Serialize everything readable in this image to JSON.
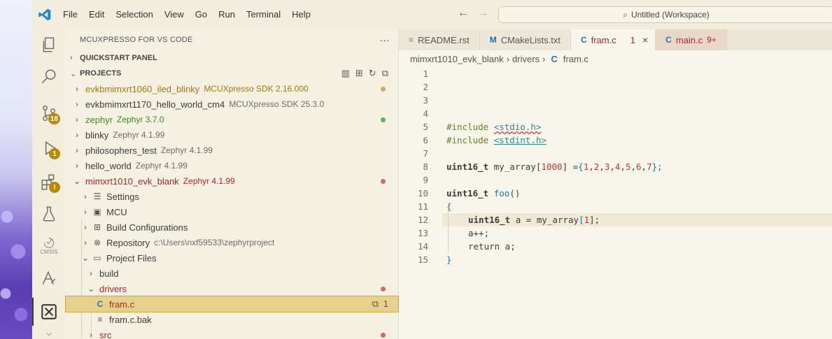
{
  "titlebar": {
    "menu": [
      "File",
      "Edit",
      "Selection",
      "View",
      "Go",
      "Run",
      "Terminal",
      "Help"
    ],
    "command_center": "Untitled (Workspace)"
  },
  "activity": {
    "scm_badge": "18",
    "debug_badge": "1",
    "cmsis_label": "CMSIS"
  },
  "sidebar": {
    "title": "MCUXPRESSO FOR VS CODE",
    "more": "···",
    "quickstart": "QUICKSTART PANEL",
    "projects": "PROJECTS",
    "project_list": [
      {
        "name": "evkbmimxrt1060_iled_blinky",
        "desc": "MCUXpresso SDK 2.16.000"
      },
      {
        "name": "evkbmimxrt1170_hello_world_cm4",
        "desc": "MCUXpresso SDK 25.3.0"
      },
      {
        "name": "zephyr",
        "desc": "Zephyr 3.7.0"
      },
      {
        "name": "blinky",
        "desc": "Zephyr 4.1.99"
      },
      {
        "name": "philosophers_test",
        "desc": "Zephyr 4.1.99"
      },
      {
        "name": "hello_world",
        "desc": "Zephyr 4.1.99"
      },
      {
        "name": "mimxrt1010_evk_blank",
        "desc": "Zephyr 4.1.99"
      }
    ],
    "children": {
      "settings": "Settings",
      "mcu": "MCU",
      "build_configs": "Build Configurations",
      "repository": "Repository",
      "repository_path": "c:\\Users\\nxf59533\\zephyrproject",
      "project_files": "Project Files",
      "build": "build",
      "drivers": "drivers",
      "fram_c": "fram.c",
      "fram_c_count": "1",
      "fram_c_bak": "fram.c.bak",
      "src": "src"
    }
  },
  "editor": {
    "tabs": [
      {
        "label": "README.rst",
        "icon": "≡",
        "suffix": ""
      },
      {
        "label": "CMakeLists.txt",
        "icon": "M",
        "suffix": ""
      },
      {
        "label": "fram.c",
        "icon": "C",
        "suffix": "1"
      },
      {
        "label": "main.c",
        "icon": "C",
        "suffix": "9+"
      }
    ],
    "breadcrumb": [
      "mimxrt1010_evk_blank",
      "drivers",
      "fram.c"
    ],
    "lines": [
      "1",
      "2",
      "3",
      "4",
      "5",
      "6",
      "7",
      "8",
      "9",
      "10",
      "11",
      "12",
      "13",
      "14",
      "15"
    ],
    "code": {
      "l5_pre": "#include ",
      "l5_inc": "<stdio.h>",
      "l6_pre": "#include ",
      "l6_inc": "<stdint.h>",
      "l8_type": "uint16_t",
      "l8_name": " my_array[",
      "l8_size": "1000",
      "l8_rest": "] =",
      "l8_open": "{",
      "l8_vals": [
        "1",
        "2",
        "3",
        "4",
        "5",
        "6",
        "7"
      ],
      "l8_close": "};",
      "l10_type": "uint16_t",
      "l10_fn": " foo",
      "l10_paren": "()",
      "l11": "{",
      "l12_type": "uint16_t",
      "l12_mid": " a = my_array",
      "l12_ob": "[",
      "l12_idx": "1",
      "l12_cb": "];",
      "l13": "a++;",
      "l14": "return a;",
      "l15": "}"
    }
  },
  "colors": {
    "accent_red": "#b5222a",
    "zephyr_green": "#3c8a1c",
    "sdk_gold": "#a07a10",
    "status_red_dot": "#d06a6a",
    "status_green_dot": "#5fb35f",
    "status_gold_dot": "#c9ad65"
  }
}
